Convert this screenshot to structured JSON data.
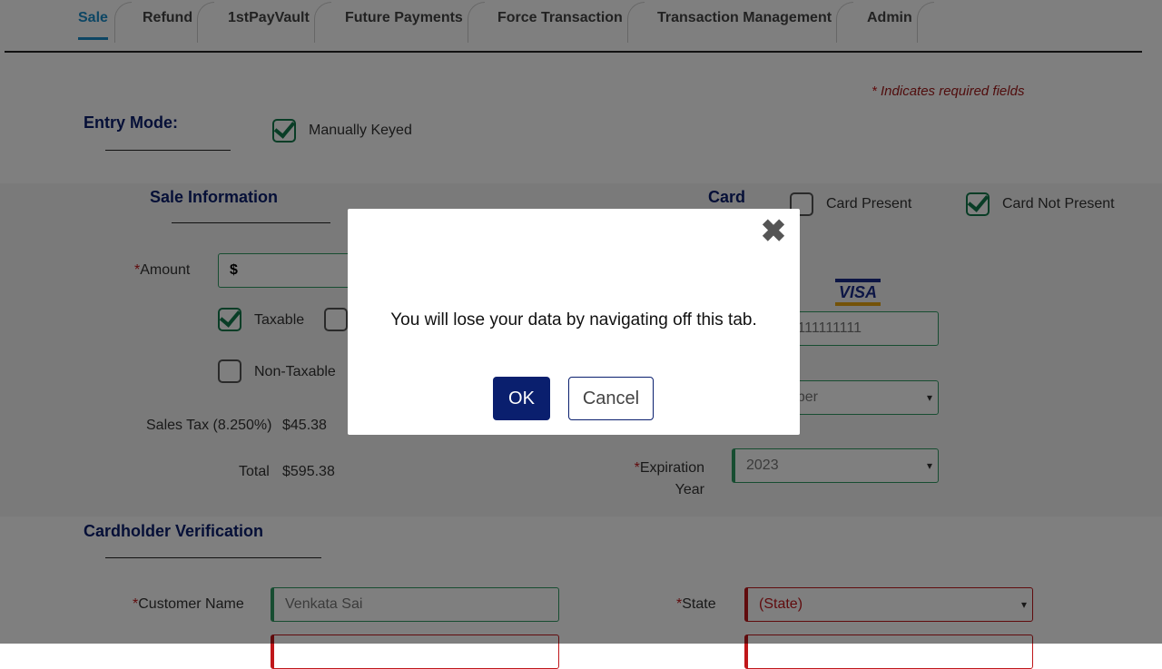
{
  "tabs": [
    {
      "label": "Sale",
      "active": true
    },
    {
      "label": "Refund"
    },
    {
      "label": "1stPayVault"
    },
    {
      "label": "Future Payments"
    },
    {
      "label": "Force Transaction"
    },
    {
      "label": "Transaction Management"
    },
    {
      "label": "Admin"
    }
  ],
  "required_note": "Indicates required fields",
  "entry_mode": {
    "title": "Entry Mode:",
    "option_label": "Manually Keyed",
    "checked": true
  },
  "sale_info": {
    "title": "Sale Information",
    "amount_label": "Amount",
    "amount_prefix": "$",
    "taxable_label": "Taxable",
    "nontaxable_label": "Non-Taxable",
    "sales_tax_label": "Sales Tax (8.250%)",
    "sales_tax_value": "$45.38",
    "total_label": "Total",
    "total_value": "$595.38"
  },
  "card": {
    "title": "Card",
    "card_present_label": "Card Present",
    "card_not_present_label": "Card Not Present",
    "card_number_value": "111111111",
    "brand": "VISA",
    "month_value": "ber",
    "expiration_year_label_1": "Expiration",
    "expiration_year_label_2": "Year",
    "expiration_year_value": "2023"
  },
  "cardholder": {
    "title": "Cardholder Verification",
    "customer_name_label": "Customer Name",
    "customer_name_value": "Venkata Sai",
    "state_label": "State",
    "state_value": "(State)"
  },
  "dialog": {
    "message": "You will lose your data by navigating off this tab.",
    "ok_label": "OK",
    "cancel_label": "Cancel",
    "close_glyph": "✖"
  },
  "colors": {
    "accent": "#1a8cc9",
    "navy": "#0a1f6e",
    "valid": "#2e9a63",
    "error": "#c0171a"
  }
}
